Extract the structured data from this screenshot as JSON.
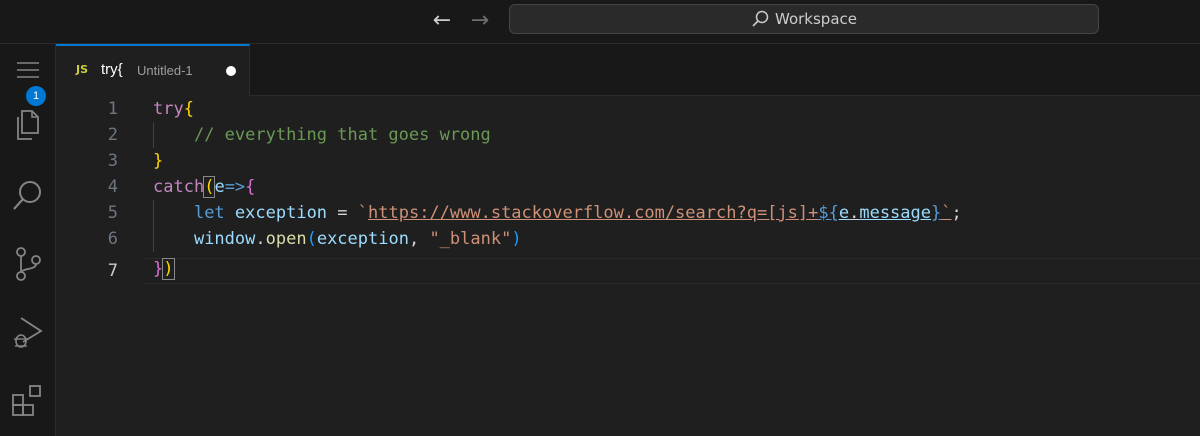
{
  "titlebar": {
    "back_label": "←",
    "forward_label": "→",
    "search_text": "Workspace"
  },
  "activitybar": {
    "items": [
      {
        "name": "menu-icon"
      },
      {
        "name": "explorer-icon"
      },
      {
        "name": "search-icon"
      },
      {
        "name": "source-control-icon"
      },
      {
        "name": "run-debug-icon"
      },
      {
        "name": "extensions-icon"
      }
    ],
    "explorer_badge": "1"
  },
  "tabs": [
    {
      "file_type": "JS",
      "name": "try{",
      "description": "Untitled-1",
      "dirty": true
    }
  ],
  "editor": {
    "active_line": 7,
    "line_numbers": [
      "1",
      "2",
      "3",
      "4",
      "5",
      "6",
      "7"
    ],
    "tokens": {
      "l1_try": "try",
      "l1_brace": "{",
      "l2_comment": "// everything that goes wrong",
      "l3_brace": "}",
      "l4_catch": "catch",
      "l4_paren": "(",
      "l4_e": "e",
      "l4_arrow": "=>",
      "l4_brace": "{",
      "l5_let": "let",
      "l5_exception": "exception",
      "l5_eq": " = ",
      "l5_tick_open": "`",
      "l5_url": "https://www.stackoverflow.com/search?q=[js]+",
      "l5_interp_open": "${",
      "l5_e": "e",
      "l5_dot": ".",
      "l5_message": "message",
      "l5_interp_close": "}",
      "l5_tick_close": "`",
      "l5_semi": ";",
      "l6_window": "window",
      "l6_dot": ".",
      "l6_open": "open",
      "l6_paren_open": "(",
      "l6_exception": "exception",
      "l6_comma": ", ",
      "l6_str": "\"_blank\"",
      "l6_paren_close": ")",
      "l7_brace": "}",
      "l7_paren": ")"
    }
  },
  "colors": {
    "accent": "#0078d4",
    "keyword_control": "#c586c0",
    "keyword": "#569cd6",
    "variable": "#9cdcfe",
    "function": "#dcdcaa",
    "string": "#ce9178",
    "comment": "#6a9955",
    "bracket_level1": "#ffd700",
    "bracket_level2": "#da70d6",
    "bracket_level3": "#179fff"
  }
}
